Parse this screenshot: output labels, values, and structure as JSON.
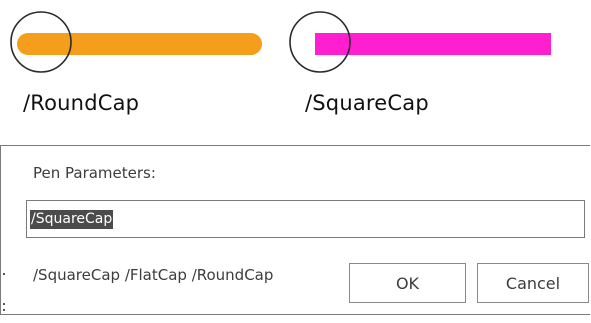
{
  "demo": {
    "round_cap": {
      "label": "/RoundCap",
      "color": "#f59e1b",
      "indicator_icon": "circle-outline-icon"
    },
    "square_cap": {
      "label": "/SquareCap",
      "color": "#ff1fcf",
      "indicator_icon": "circle-outline-icon"
    }
  },
  "dialog": {
    "title": "Pen Parameters:",
    "input_value": "/SquareCap",
    "options_hint": "/SquareCap /FlatCap /RoundCap",
    "ok_label": "OK",
    "cancel_label": "Cancel"
  },
  "colors": {
    "selection_bg": "#4b4b4b",
    "border": "#7a7a7a",
    "text": "#3c3c3c"
  }
}
